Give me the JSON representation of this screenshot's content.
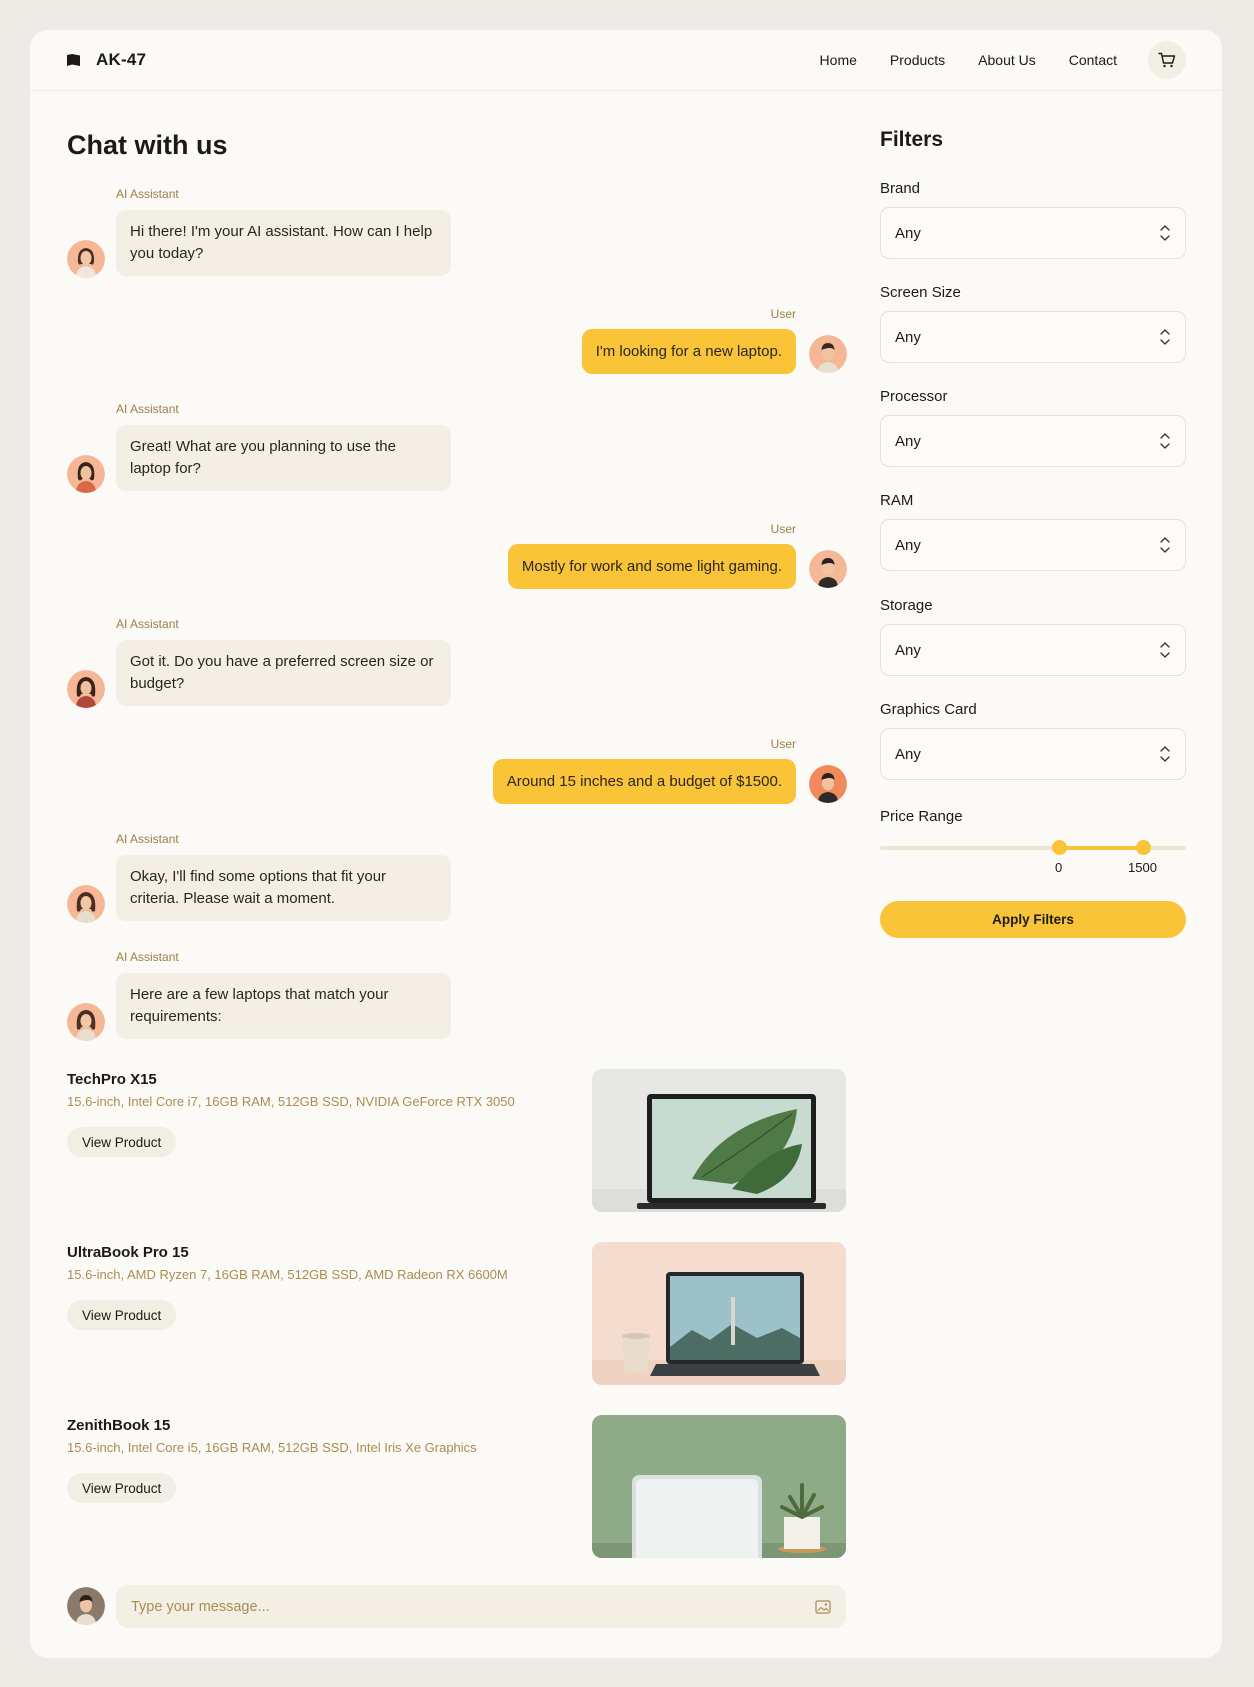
{
  "header": {
    "brand": "AK-47",
    "nav": [
      "Home",
      "Products",
      "About Us",
      "Contact"
    ],
    "cart_icon": "cart-icon"
  },
  "chat": {
    "title": "Chat with us",
    "messages": [
      {
        "role": "ai",
        "sender": "AI Assistant",
        "text": "Hi there! I'm your AI assistant. How can I help you today?"
      },
      {
        "role": "user",
        "sender": "User",
        "text": "I'm looking for a new laptop."
      },
      {
        "role": "ai",
        "sender": "AI Assistant",
        "text": "Great! What are you planning to use the laptop for?"
      },
      {
        "role": "user",
        "sender": "User",
        "text": "Mostly for work and some light gaming."
      },
      {
        "role": "ai",
        "sender": "AI Assistant",
        "text": "Got it. Do you have a preferred screen size or budget?"
      },
      {
        "role": "user",
        "sender": "User",
        "text": "Around 15 inches and a budget of $1500."
      },
      {
        "role": "ai",
        "sender": "AI Assistant",
        "text": "Okay, I'll find some options that fit your criteria. Please wait a moment."
      },
      {
        "role": "ai",
        "sender": "AI Assistant",
        "text": "Here are a few laptops that match your requirements:"
      }
    ],
    "products": [
      {
        "name": "TechPro X15",
        "specs": "15.6-inch, Intel Core i7, 16GB RAM, 512GB SSD, NVIDIA GeForce RTX 3050",
        "button": "View Product"
      },
      {
        "name": "UltraBook Pro 15",
        "specs": "15.6-inch, AMD Ryzen 7, 16GB RAM, 512GB SSD, AMD Radeon RX 6600M",
        "button": "View Product"
      },
      {
        "name": "ZenithBook 15",
        "specs": "15.6-inch, Intel Core i5, 16GB RAM, 512GB SSD, Intel Iris Xe Graphics",
        "button": "View Product"
      }
    ],
    "composer": {
      "placeholder": "Type your message...",
      "attach_icon": "image-icon"
    }
  },
  "filters": {
    "title": "Filters",
    "fields": [
      {
        "label": "Brand",
        "value": "Any"
      },
      {
        "label": "Screen Size",
        "value": "Any"
      },
      {
        "label": "Processor",
        "value": "Any"
      },
      {
        "label": "RAM",
        "value": "Any"
      },
      {
        "label": "Storage",
        "value": "Any"
      },
      {
        "label": "Graphics Card",
        "value": "Any"
      }
    ],
    "price_range": {
      "label": "Price Range",
      "min": "0",
      "max": "1500"
    },
    "apply_label": "Apply Filters"
  },
  "colors": {
    "accent": "#f9c437",
    "bubble_ai": "#f3efe4",
    "muted_text": "#a98d52"
  }
}
